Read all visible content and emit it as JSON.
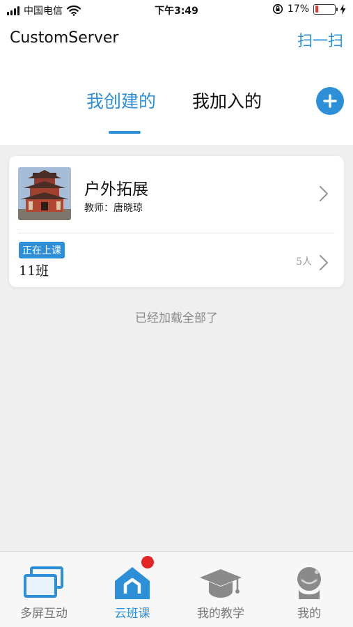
{
  "status_bar": {
    "carrier": "中国电信",
    "time": "下午3:49",
    "battery_percent": "17%",
    "battery_level": 0.17
  },
  "header": {
    "title": "CustomServer",
    "scan_label": "扫一扫"
  },
  "tabs": [
    {
      "label": "我创建的",
      "active": true
    },
    {
      "label": "我加入的",
      "active": false
    }
  ],
  "course_card": {
    "course_name": "户外拓展",
    "teacher": "教师：唐晓琼",
    "status_badge": "正在上课",
    "class_name": "11班",
    "member_count": "5人"
  },
  "list_footer": "已经加载全部了",
  "bottom_nav": [
    {
      "label": "多屏互动",
      "icon": "screens-icon",
      "active": false
    },
    {
      "label": "云班课",
      "icon": "home-icon",
      "active": true,
      "has_notification": true
    },
    {
      "label": "我的教学",
      "icon": "graduation-cap-icon",
      "active": false
    },
    {
      "label": "我的",
      "icon": "user-icon",
      "active": false
    }
  ],
  "colors": {
    "accent": "#2d8fd8",
    "notification": "#e52525",
    "background": "#efefef"
  }
}
